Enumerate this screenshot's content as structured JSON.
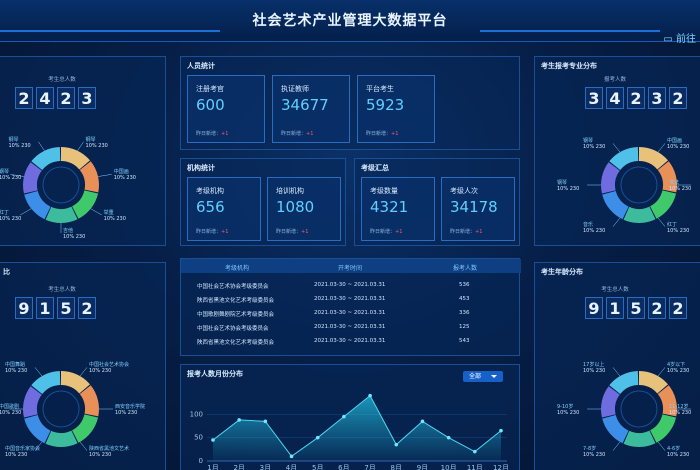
{
  "header": {
    "title": "社会艺术产业管理大数据平台",
    "btn": "前往"
  },
  "left_top": {
    "label": "考生总人数",
    "digits": [
      "2",
      "4",
      "2",
      "3"
    ],
    "legend": [
      {
        "name": "钢琴",
        "v": "10%",
        "n": "230"
      },
      {
        "name": "中国画",
        "v": "10%",
        "n": "230"
      },
      {
        "name": "举重",
        "v": "10%",
        "n": "230"
      },
      {
        "name": "吉他",
        "v": "10%",
        "n": "230"
      },
      {
        "name": "红丁",
        "v": "10%",
        "n": "230"
      },
      {
        "name": "钢琴",
        "v": "10%",
        "n": "230"
      },
      {
        "name": "钢琴",
        "v": "10%",
        "n": "230"
      }
    ]
  },
  "left_bottom": {
    "title": "比",
    "label": "考生总人数",
    "digits": [
      "9",
      "1",
      "5",
      "2"
    ],
    "legend": [
      {
        "name": "中国社会艺术协会",
        "v": "10%",
        "n": "230"
      },
      {
        "name": "西安音乐学院",
        "v": "10%",
        "n": "230"
      },
      {
        "name": "陕西省黑池文艺术",
        "v": "10%",
        "n": "230"
      },
      {
        "name": "中国音乐家协会",
        "v": "10%",
        "n": "230"
      },
      {
        "name": "中国歌剧",
        "v": "10%",
        "n": "230"
      },
      {
        "name": "中国舞蹈",
        "v": "10%",
        "n": "230"
      }
    ]
  },
  "right_top": {
    "title": "考生报考专业分布",
    "label": "报考人数",
    "digits": [
      "3",
      "4",
      "2",
      "3",
      "2"
    ],
    "legend": [
      {
        "name": "中国画",
        "v": "10%",
        "n": "230"
      },
      {
        "name": "书法",
        "v": "10%",
        "n": "230"
      },
      {
        "name": "红丁",
        "v": "10%",
        "n": "230"
      },
      {
        "name": "音乐",
        "v": "10%",
        "n": "230"
      },
      {
        "name": "钢琴",
        "v": "10%",
        "n": "230"
      },
      {
        "name": "钢琴",
        "v": "10%",
        "n": "230"
      }
    ]
  },
  "right_bottom": {
    "title": "考生年龄分布",
    "label": "考生总人数",
    "digits": [
      "9",
      "1",
      "5",
      "2",
      "2"
    ],
    "legend": [
      {
        "name": "4岁以下",
        "v": "10%",
        "n": "230"
      },
      {
        "name": "11-12岁",
        "v": "10%",
        "n": "230"
      },
      {
        "name": "4-6岁",
        "v": "10%",
        "n": "230"
      },
      {
        "name": "7-8岁",
        "v": "10%",
        "n": "230"
      },
      {
        "name": "9-10岁",
        "v": "10%",
        "n": "230"
      },
      {
        "name": "17岁以上",
        "v": "10%",
        "n": "230"
      }
    ]
  },
  "people": {
    "title": "人员统计",
    "cards": [
      {
        "label": "注册考官",
        "value": "600"
      },
      {
        "label": "执证教师",
        "value": "34677"
      },
      {
        "label": "平台考生",
        "value": "5923"
      }
    ],
    "foot": "昨日新增：",
    "foot_v": "+1"
  },
  "org": {
    "title": "机构统计",
    "cards": [
      {
        "label": "考级机构",
        "value": "656"
      },
      {
        "label": "培训机构",
        "value": "1080"
      }
    ]
  },
  "exam": {
    "title": "考级汇总",
    "cards": [
      {
        "label": "考级数量",
        "value": "4321"
      },
      {
        "label": "考级人次",
        "value": "34178"
      }
    ]
  },
  "table": {
    "headers": [
      "考级机构",
      "开考时间",
      "报考人数"
    ],
    "rows": [
      [
        "中国社会艺术协会考级委员会",
        "2021.03-30 ~ 2021.03.31",
        "536"
      ],
      [
        "陕西省黑池文化艺术考级委员会",
        "2021.03-30 ~ 2021.03.31",
        "453"
      ],
      [
        "中国歌剧舞剧院艺术考级委员会",
        "2021.03-30 ~ 2021.03.31",
        "336"
      ],
      [
        "中国社会艺术协会考级委员会",
        "2021.03-30 ~ 2021.03.31",
        "125"
      ],
      [
        "陕西省黑池文化艺术考级委员会",
        "2021.03-30 ~ 2021.03.31",
        "543"
      ]
    ]
  },
  "chart": {
    "title": "报考人数月份分布",
    "select": "全部"
  },
  "chart_data": {
    "type": "area",
    "categories": [
      "1月",
      "2月",
      "3月",
      "4月",
      "5月",
      "6月",
      "7月",
      "8月",
      "9月",
      "10月",
      "11月",
      "12月"
    ],
    "values": [
      45,
      88,
      85,
      10,
      50,
      95,
      140,
      35,
      85,
      50,
      20,
      65
    ],
    "ylim": [
      0,
      150
    ],
    "yticks": [
      0,
      50,
      100
    ]
  },
  "colors": {
    "ring": [
      "#e8c27a",
      "#e98f58",
      "#40c96a",
      "#3dbb9d",
      "#3d8ee8",
      "#6f6ce0",
      "#4fc0e8"
    ]
  }
}
